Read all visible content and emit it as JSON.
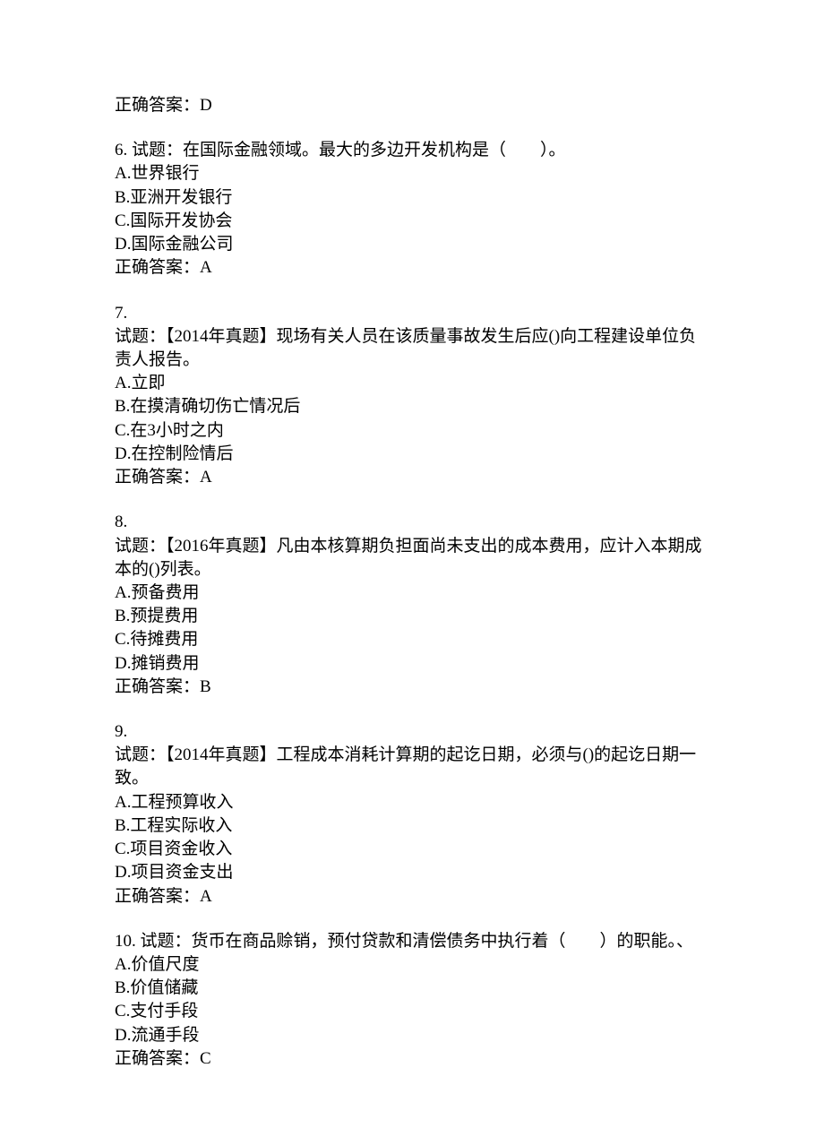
{
  "prev_answer": "正确答案：D",
  "questions": [
    {
      "number": "6.",
      "prompt_inline": "试题：在国际金融领域。最大的多边开发机构是（　　）。",
      "prompt_lines": [],
      "options": [
        "A.世界银行",
        "B.亚洲开发银行",
        "C.国际开发协会",
        "D.国际金融公司"
      ],
      "answer": "正确答案：A"
    },
    {
      "number": "7.",
      "prompt_inline": "",
      "prompt_lines": [
        "试题：【2014年真题】现场有关人员在该质量事故发生后应()向工程建设单位负责人报告。"
      ],
      "options": [
        "A.立即",
        "B.在摸清确切伤亡情况后",
        "C.在3小时之内",
        "D.在控制险情后"
      ],
      "answer": "正确答案：A"
    },
    {
      "number": "8.",
      "prompt_inline": "",
      "prompt_lines": [
        "试题：【2016年真题】凡由本核算期负担面尚未支出的成本费用，应计入本期成本的()列表。"
      ],
      "options": [
        "A.预备费用",
        "B.预提费用",
        "C.待摊费用",
        "D.摊销费用"
      ],
      "answer": "正确答案：B"
    },
    {
      "number": "9.",
      "prompt_inline": "",
      "prompt_lines": [
        "试题：【2014年真题】工程成本消耗计算期的起讫日期，必须与()的起讫日期一致。"
      ],
      "options": [
        "A.工程预算收入",
        "B.工程实际收入",
        "C.项目资金收入",
        "D.项目资金支出"
      ],
      "answer": "正确答案：A"
    },
    {
      "number": "10.",
      "prompt_inline": "试题：货币在商品赊销，预付贷款和清偿债务中执行着（　　）的职能。、",
      "prompt_lines": [],
      "options": [
        "A.价值尺度",
        "B.价值储藏",
        "C.支付手段",
        "D.流通手段"
      ],
      "answer": "正确答案：C"
    }
  ]
}
